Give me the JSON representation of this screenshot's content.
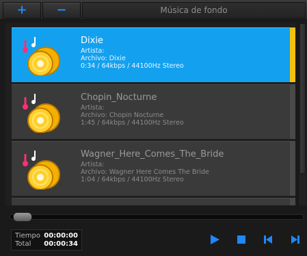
{
  "toolbar": {
    "add_label": "+",
    "remove_label": "−",
    "title": "Música de fondo"
  },
  "tracks": [
    {
      "title": "Dixie",
      "artist": "Artista:",
      "file": "Archivo: Dixie",
      "info": "0:34 / 64kbps / 44100Hz Stereo",
      "selected": true
    },
    {
      "title": "Chopin_Nocturne",
      "artist": "Artista:",
      "file": "Archivo: Chopin Nocturne",
      "info": "1:45 / 64kbps / 44100Hz Stereo",
      "selected": false
    },
    {
      "title": "Wagner_Here_Comes_The_Bride",
      "artist": "Artista:",
      "file": "Archivo: Wagner Here Comes The Bride",
      "info": "1:04 / 64kbps / 44100Hz Stereo",
      "selected": false
    }
  ],
  "time": {
    "elapsed_label": "Tiempo",
    "elapsed_value": "00:00:00",
    "total_label": "Total",
    "total_value": "00:00:34"
  },
  "seek_position": 0,
  "controls": {
    "play_icon": "play-icon",
    "stop_icon": "stop-icon",
    "prev_icon": "previous-icon",
    "next_icon": "next-icon"
  },
  "colors": {
    "accent": "#1e88ff",
    "selected_bg": "#13a1ef",
    "selected_edge": "#f4c20d"
  }
}
